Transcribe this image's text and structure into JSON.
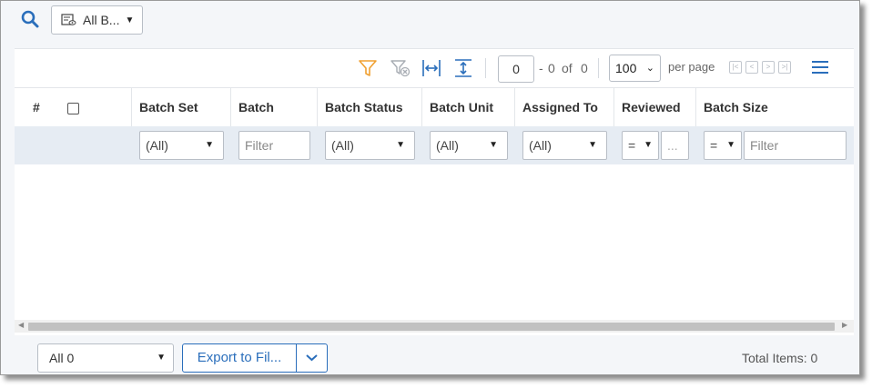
{
  "toolbar_top": {
    "view_label": "All B..."
  },
  "grid_toolbar": {
    "page_value": "0",
    "page_dash": "-",
    "page_from": "0",
    "page_of": "of",
    "page_total": "0",
    "per_page_value": "100",
    "per_page_label": "per page"
  },
  "columns": {
    "num": "#",
    "batch_set": "Batch Set",
    "batch": "Batch",
    "batch_status": "Batch Status",
    "batch_unit": "Batch Unit",
    "assigned_to": "Assigned To",
    "reviewed": "Reviewed",
    "batch_size": "Batch Size"
  },
  "filters": {
    "batch_set": "(All)",
    "batch_placeholder": "Filter",
    "batch_status": "(All)",
    "batch_unit": "(All)",
    "assigned_to": "(All)",
    "reviewed_op": "=",
    "reviewed_value": "...",
    "batch_size_op": "=",
    "batch_size_placeholder": "Filter"
  },
  "footer": {
    "select_value": "All 0",
    "export_label": "Export to Fil...",
    "total_items": "Total Items: 0"
  },
  "colors": {
    "accent": "#2a6ebb",
    "filter_orange": "#f0a030"
  },
  "icons": [
    "search-icon",
    "view-icon",
    "filter-icon",
    "clear-filter-icon",
    "fit-width-icon",
    "fit-height-icon",
    "menu-icon"
  ]
}
